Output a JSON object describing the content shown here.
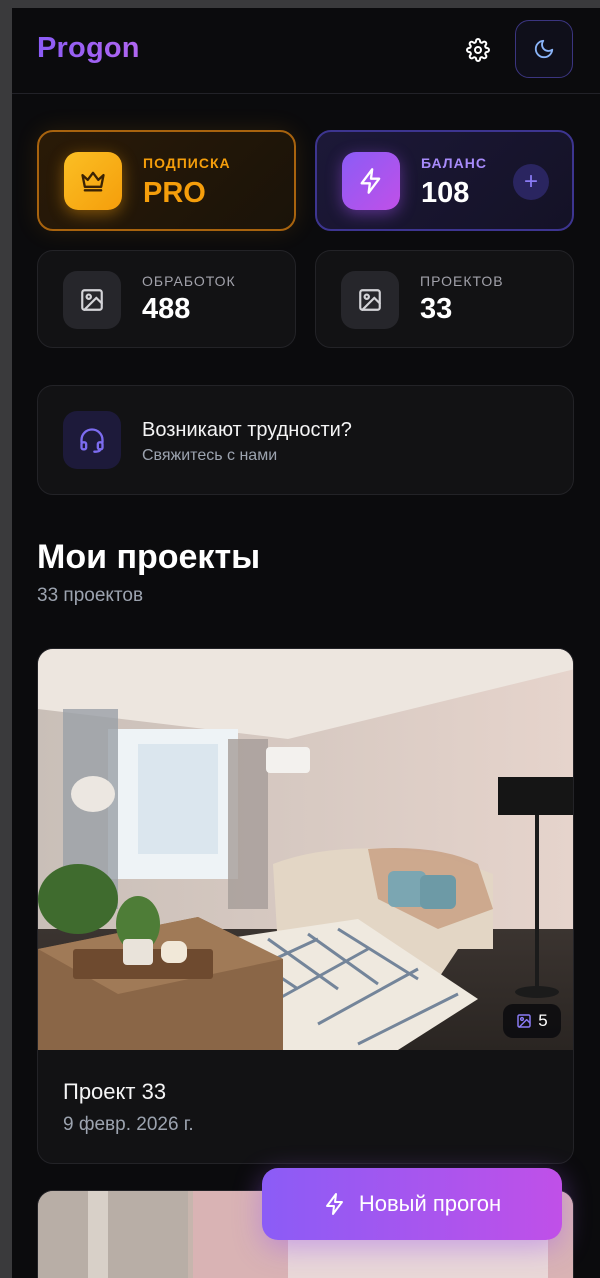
{
  "app": {
    "title": "Progon"
  },
  "header": {
    "settings_icon": "gear-icon",
    "theme_icon": "moon-icon"
  },
  "subscription": {
    "label": "ПОДПИСКА",
    "value": "PRO",
    "icon": "crown-icon",
    "color": "#f59e0b"
  },
  "balance": {
    "label": "БАЛАНС",
    "value": "108",
    "icon": "bolt-icon",
    "add_label": "+",
    "color": "#8b5cf6"
  },
  "stats": [
    {
      "label": "ОБРАБОТОК",
      "value": "488",
      "icon": "image-icon"
    },
    {
      "label": "ПРОЕКТОВ",
      "value": "33",
      "icon": "image-icon"
    }
  ],
  "help": {
    "title": "Возникают трудности?",
    "subtitle": "Свяжитесь с нами",
    "icon": "headset-icon"
  },
  "projects_section": {
    "title": "Мои проекты",
    "count_text": "33 проектов"
  },
  "projects": [
    {
      "name": "Проект 33",
      "date": "9 февр. 2026 г.",
      "images": "5"
    }
  ],
  "fab": {
    "label": "Новый прогон",
    "icon": "bolt-icon"
  }
}
